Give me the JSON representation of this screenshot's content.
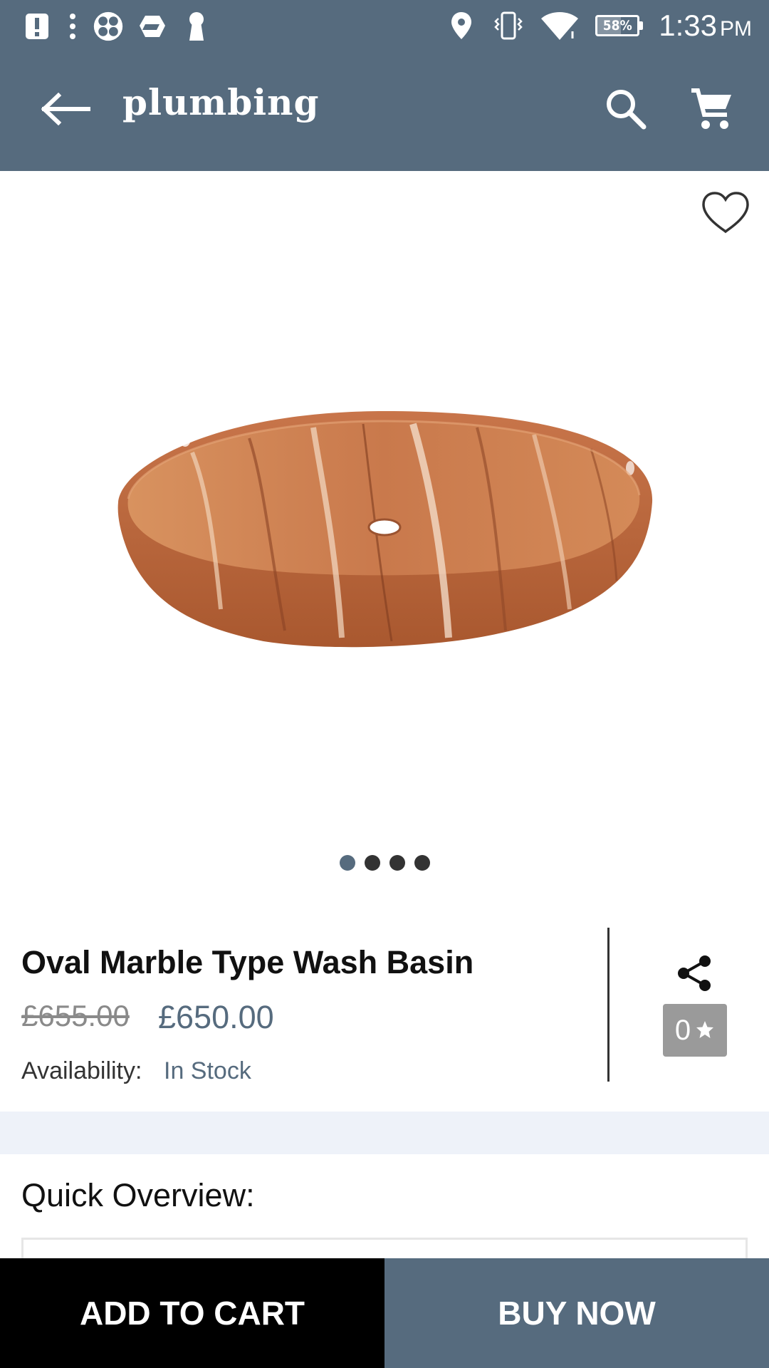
{
  "status_bar": {
    "time": "1:33",
    "ampm": "PM",
    "battery_percent": "58%",
    "battery_level": 0.58,
    "left_icons": [
      "alert-icon",
      "more-dots-icon",
      "fan-icon",
      "dropbox-icon",
      "keyhole-icon"
    ],
    "right_icons": [
      "location-icon",
      "vibrate-icon",
      "wifi-icon",
      "battery-icon"
    ]
  },
  "toolbar": {
    "logo_text": "plumbing",
    "back_icon": "arrow-left-icon",
    "search_icon": "search-icon",
    "cart_icon": "cart-icon",
    "background_color": "#566b7e"
  },
  "product": {
    "title": "Oval Marble Type Wash Basin",
    "old_price": "£655.00",
    "price": "£650.00",
    "availability_label": "Availability:",
    "availability_value": "In Stock",
    "rating_count": "0",
    "image_description_icon": "wash-basin-image",
    "image_count": 4,
    "active_image_index": 0
  },
  "overview": {
    "title": "Quick Overview:"
  },
  "actions": {
    "add_to_cart_label": "ADD TO CART",
    "buy_now_label": "BUY NOW"
  },
  "colors": {
    "accent": "#566b7e",
    "separator": "#eef2f9",
    "badge": "#9a9a9a"
  }
}
